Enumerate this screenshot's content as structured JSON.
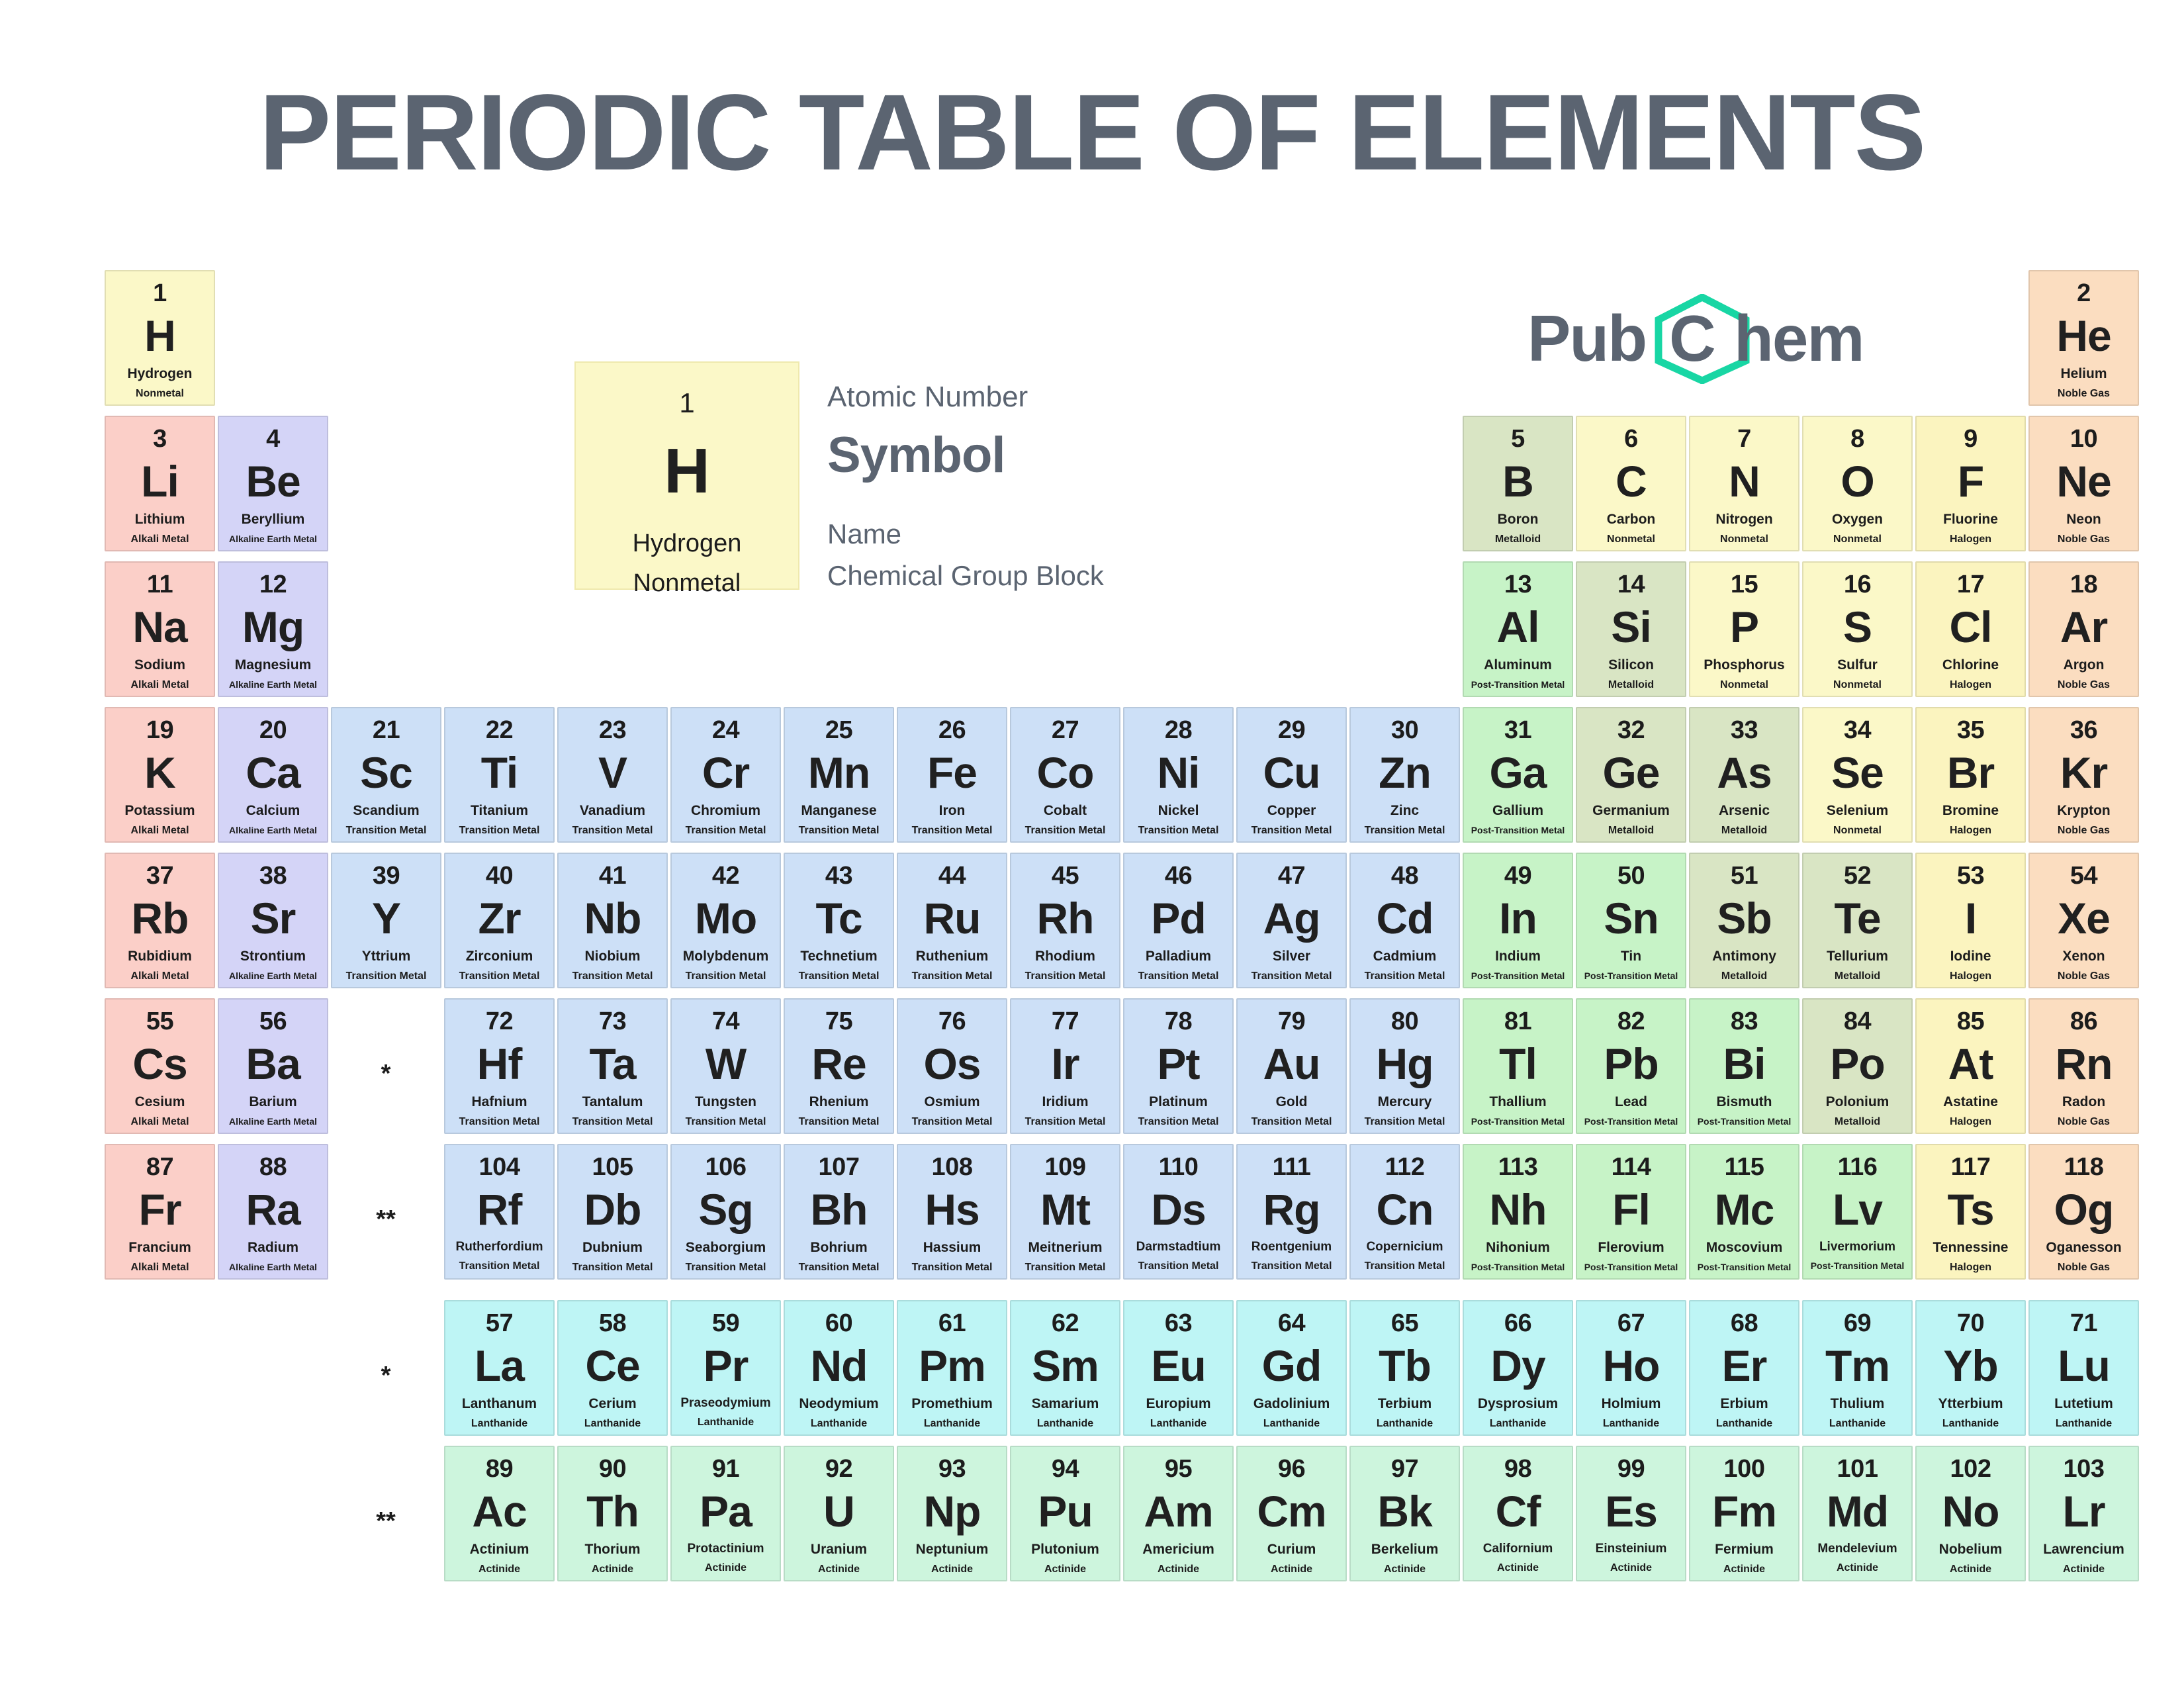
{
  "title": "PERIODIC TABLE OF ELEMENTS",
  "legend": {
    "number": "1",
    "symbol": "H",
    "name": "Hydrogen",
    "group_block": "Nonmetal",
    "label_atomic_number": "Atomic Number",
    "label_symbol": "Symbol",
    "label_name": "Name",
    "label_group_block": "Chemical Group Block"
  },
  "logo": {
    "part1": "Pub",
    "part2": "C",
    "part3": "hem",
    "hex_color": "#18d6a4",
    "text_color": "#5b6471"
  },
  "markers": {
    "lanthanide": "*",
    "actinide": "**"
  },
  "category_colors": {
    "Nonmetal": "#fbf8c8",
    "Noble Gas": "#fbddc0",
    "Alkali Metal": "#fbcfc8",
    "Alkaline Earth Metal": "#d4d4f7",
    "Metalloid": "#d9e5c4",
    "Halogen": "#fbf4bf",
    "Post-Transition Metal": "#c7f3c7",
    "Transition Metal": "#cde0f7",
    "Lanthanide": "#bef5f5",
    "Actinide": "#cdf5dd"
  },
  "elements": [
    {
      "n": 1,
      "s": "H",
      "name": "Hydrogen",
      "g": "Nonmetal",
      "col": 1,
      "row": 1
    },
    {
      "n": 2,
      "s": "He",
      "name": "Helium",
      "g": "Noble Gas",
      "col": 18,
      "row": 1
    },
    {
      "n": 3,
      "s": "Li",
      "name": "Lithium",
      "g": "Alkali Metal",
      "col": 1,
      "row": 2
    },
    {
      "n": 4,
      "s": "Be",
      "name": "Beryllium",
      "g": "Alkaline Earth Metal",
      "col": 2,
      "row": 2
    },
    {
      "n": 5,
      "s": "B",
      "name": "Boron",
      "g": "Metalloid",
      "col": 13,
      "row": 2
    },
    {
      "n": 6,
      "s": "C",
      "name": "Carbon",
      "g": "Nonmetal",
      "col": 14,
      "row": 2
    },
    {
      "n": 7,
      "s": "N",
      "name": "Nitrogen",
      "g": "Nonmetal",
      "col": 15,
      "row": 2
    },
    {
      "n": 8,
      "s": "O",
      "name": "Oxygen",
      "g": "Nonmetal",
      "col": 16,
      "row": 2
    },
    {
      "n": 9,
      "s": "F",
      "name": "Fluorine",
      "g": "Halogen",
      "col": 17,
      "row": 2
    },
    {
      "n": 10,
      "s": "Ne",
      "name": "Neon",
      "g": "Noble Gas",
      "col": 18,
      "row": 2
    },
    {
      "n": 11,
      "s": "Na",
      "name": "Sodium",
      "g": "Alkali Metal",
      "col": 1,
      "row": 3
    },
    {
      "n": 12,
      "s": "Mg",
      "name": "Magnesium",
      "g": "Alkaline Earth Metal",
      "col": 2,
      "row": 3
    },
    {
      "n": 13,
      "s": "Al",
      "name": "Aluminum",
      "g": "Post-Transition Metal",
      "col": 13,
      "row": 3
    },
    {
      "n": 14,
      "s": "Si",
      "name": "Silicon",
      "g": "Metalloid",
      "col": 14,
      "row": 3
    },
    {
      "n": 15,
      "s": "P",
      "name": "Phosphorus",
      "g": "Nonmetal",
      "col": 15,
      "row": 3
    },
    {
      "n": 16,
      "s": "S",
      "name": "Sulfur",
      "g": "Nonmetal",
      "col": 16,
      "row": 3
    },
    {
      "n": 17,
      "s": "Cl",
      "name": "Chlorine",
      "g": "Halogen",
      "col": 17,
      "row": 3
    },
    {
      "n": 18,
      "s": "Ar",
      "name": "Argon",
      "g": "Noble Gas",
      "col": 18,
      "row": 3
    },
    {
      "n": 19,
      "s": "K",
      "name": "Potassium",
      "g": "Alkali Metal",
      "col": 1,
      "row": 4
    },
    {
      "n": 20,
      "s": "Ca",
      "name": "Calcium",
      "g": "Alkaline Earth Metal",
      "col": 2,
      "row": 4
    },
    {
      "n": 21,
      "s": "Sc",
      "name": "Scandium",
      "g": "Transition Metal",
      "col": 3,
      "row": 4
    },
    {
      "n": 22,
      "s": "Ti",
      "name": "Titanium",
      "g": "Transition Metal",
      "col": 4,
      "row": 4
    },
    {
      "n": 23,
      "s": "V",
      "name": "Vanadium",
      "g": "Transition Metal",
      "col": 5,
      "row": 4
    },
    {
      "n": 24,
      "s": "Cr",
      "name": "Chromium",
      "g": "Transition Metal",
      "col": 6,
      "row": 4
    },
    {
      "n": 25,
      "s": "Mn",
      "name": "Manganese",
      "g": "Transition Metal",
      "col": 7,
      "row": 4
    },
    {
      "n": 26,
      "s": "Fe",
      "name": "Iron",
      "g": "Transition Metal",
      "col": 8,
      "row": 4
    },
    {
      "n": 27,
      "s": "Co",
      "name": "Cobalt",
      "g": "Transition Metal",
      "col": 9,
      "row": 4
    },
    {
      "n": 28,
      "s": "Ni",
      "name": "Nickel",
      "g": "Transition Metal",
      "col": 10,
      "row": 4
    },
    {
      "n": 29,
      "s": "Cu",
      "name": "Copper",
      "g": "Transition Metal",
      "col": 11,
      "row": 4
    },
    {
      "n": 30,
      "s": "Zn",
      "name": "Zinc",
      "g": "Transition Metal",
      "col": 12,
      "row": 4
    },
    {
      "n": 31,
      "s": "Ga",
      "name": "Gallium",
      "g": "Post-Transition Metal",
      "col": 13,
      "row": 4
    },
    {
      "n": 32,
      "s": "Ge",
      "name": "Germanium",
      "g": "Metalloid",
      "col": 14,
      "row": 4
    },
    {
      "n": 33,
      "s": "As",
      "name": "Arsenic",
      "g": "Metalloid",
      "col": 15,
      "row": 4
    },
    {
      "n": 34,
      "s": "Se",
      "name": "Selenium",
      "g": "Nonmetal",
      "col": 16,
      "row": 4
    },
    {
      "n": 35,
      "s": "Br",
      "name": "Bromine",
      "g": "Halogen",
      "col": 17,
      "row": 4
    },
    {
      "n": 36,
      "s": "Kr",
      "name": "Krypton",
      "g": "Noble Gas",
      "col": 18,
      "row": 4
    },
    {
      "n": 37,
      "s": "Rb",
      "name": "Rubidium",
      "g": "Alkali Metal",
      "col": 1,
      "row": 5
    },
    {
      "n": 38,
      "s": "Sr",
      "name": "Strontium",
      "g": "Alkaline Earth Metal",
      "col": 2,
      "row": 5
    },
    {
      "n": 39,
      "s": "Y",
      "name": "Yttrium",
      "g": "Transition Metal",
      "col": 3,
      "row": 5
    },
    {
      "n": 40,
      "s": "Zr",
      "name": "Zirconium",
      "g": "Transition Metal",
      "col": 4,
      "row": 5
    },
    {
      "n": 41,
      "s": "Nb",
      "name": "Niobium",
      "g": "Transition Metal",
      "col": 5,
      "row": 5
    },
    {
      "n": 42,
      "s": "Mo",
      "name": "Molybdenum",
      "g": "Transition Metal",
      "col": 6,
      "row": 5
    },
    {
      "n": 43,
      "s": "Tc",
      "name": "Technetium",
      "g": "Transition Metal",
      "col": 7,
      "row": 5
    },
    {
      "n": 44,
      "s": "Ru",
      "name": "Ruthenium",
      "g": "Transition Metal",
      "col": 8,
      "row": 5
    },
    {
      "n": 45,
      "s": "Rh",
      "name": "Rhodium",
      "g": "Transition Metal",
      "col": 9,
      "row": 5
    },
    {
      "n": 46,
      "s": "Pd",
      "name": "Palladium",
      "g": "Transition Metal",
      "col": 10,
      "row": 5
    },
    {
      "n": 47,
      "s": "Ag",
      "name": "Silver",
      "g": "Transition Metal",
      "col": 11,
      "row": 5
    },
    {
      "n": 48,
      "s": "Cd",
      "name": "Cadmium",
      "g": "Transition Metal",
      "col": 12,
      "row": 5
    },
    {
      "n": 49,
      "s": "In",
      "name": "Indium",
      "g": "Post-Transition Metal",
      "col": 13,
      "row": 5
    },
    {
      "n": 50,
      "s": "Sn",
      "name": "Tin",
      "g": "Post-Transition Metal",
      "col": 14,
      "row": 5
    },
    {
      "n": 51,
      "s": "Sb",
      "name": "Antimony",
      "g": "Metalloid",
      "col": 15,
      "row": 5
    },
    {
      "n": 52,
      "s": "Te",
      "name": "Tellurium",
      "g": "Metalloid",
      "col": 16,
      "row": 5
    },
    {
      "n": 53,
      "s": "I",
      "name": "Iodine",
      "g": "Halogen",
      "col": 17,
      "row": 5
    },
    {
      "n": 54,
      "s": "Xe",
      "name": "Xenon",
      "g": "Noble Gas",
      "col": 18,
      "row": 5
    },
    {
      "n": 55,
      "s": "Cs",
      "name": "Cesium",
      "g": "Alkali Metal",
      "col": 1,
      "row": 6
    },
    {
      "n": 56,
      "s": "Ba",
      "name": "Barium",
      "g": "Alkaline Earth Metal",
      "col": 2,
      "row": 6
    },
    {
      "n": 72,
      "s": "Hf",
      "name": "Hafnium",
      "g": "Transition Metal",
      "col": 4,
      "row": 6
    },
    {
      "n": 73,
      "s": "Ta",
      "name": "Tantalum",
      "g": "Transition Metal",
      "col": 5,
      "row": 6
    },
    {
      "n": 74,
      "s": "W",
      "name": "Tungsten",
      "g": "Transition Metal",
      "col": 6,
      "row": 6
    },
    {
      "n": 75,
      "s": "Re",
      "name": "Rhenium",
      "g": "Transition Metal",
      "col": 7,
      "row": 6
    },
    {
      "n": 76,
      "s": "Os",
      "name": "Osmium",
      "g": "Transition Metal",
      "col": 8,
      "row": 6
    },
    {
      "n": 77,
      "s": "Ir",
      "name": "Iridium",
      "g": "Transition Metal",
      "col": 9,
      "row": 6
    },
    {
      "n": 78,
      "s": "Pt",
      "name": "Platinum",
      "g": "Transition Metal",
      "col": 10,
      "row": 6
    },
    {
      "n": 79,
      "s": "Au",
      "name": "Gold",
      "g": "Transition Metal",
      "col": 11,
      "row": 6
    },
    {
      "n": 80,
      "s": "Hg",
      "name": "Mercury",
      "g": "Transition Metal",
      "col": 12,
      "row": 6
    },
    {
      "n": 81,
      "s": "Tl",
      "name": "Thallium",
      "g": "Post-Transition Metal",
      "col": 13,
      "row": 6
    },
    {
      "n": 82,
      "s": "Pb",
      "name": "Lead",
      "g": "Post-Transition Metal",
      "col": 14,
      "row": 6
    },
    {
      "n": 83,
      "s": "Bi",
      "name": "Bismuth",
      "g": "Post-Transition Metal",
      "col": 15,
      "row": 6
    },
    {
      "n": 84,
      "s": "Po",
      "name": "Polonium",
      "g": "Metalloid",
      "col": 16,
      "row": 6
    },
    {
      "n": 85,
      "s": "At",
      "name": "Astatine",
      "g": "Halogen",
      "col": 17,
      "row": 6
    },
    {
      "n": 86,
      "s": "Rn",
      "name": "Radon",
      "g": "Noble Gas",
      "col": 18,
      "row": 6
    },
    {
      "n": 87,
      "s": "Fr",
      "name": "Francium",
      "g": "Alkali Metal",
      "col": 1,
      "row": 7
    },
    {
      "n": 88,
      "s": "Ra",
      "name": "Radium",
      "g": "Alkaline Earth Metal",
      "col": 2,
      "row": 7
    },
    {
      "n": 104,
      "s": "Rf",
      "name": "Rutherfordium",
      "g": "Transition Metal",
      "col": 4,
      "row": 7
    },
    {
      "n": 105,
      "s": "Db",
      "name": "Dubnium",
      "g": "Transition Metal",
      "col": 5,
      "row": 7
    },
    {
      "n": 106,
      "s": "Sg",
      "name": "Seaborgium",
      "g": "Transition Metal",
      "col": 6,
      "row": 7
    },
    {
      "n": 107,
      "s": "Bh",
      "name": "Bohrium",
      "g": "Transition Metal",
      "col": 7,
      "row": 7
    },
    {
      "n": 108,
      "s": "Hs",
      "name": "Hassium",
      "g": "Transition Metal",
      "col": 8,
      "row": 7
    },
    {
      "n": 109,
      "s": "Mt",
      "name": "Meitnerium",
      "g": "Transition Metal",
      "col": 9,
      "row": 7
    },
    {
      "n": 110,
      "s": "Ds",
      "name": "Darmstadtium",
      "g": "Transition Metal",
      "col": 10,
      "row": 7
    },
    {
      "n": 111,
      "s": "Rg",
      "name": "Roentgenium",
      "g": "Transition Metal",
      "col": 11,
      "row": 7
    },
    {
      "n": 112,
      "s": "Cn",
      "name": "Copernicium",
      "g": "Transition Metal",
      "col": 12,
      "row": 7
    },
    {
      "n": 113,
      "s": "Nh",
      "name": "Nihonium",
      "g": "Post-Transition Metal",
      "col": 13,
      "row": 7
    },
    {
      "n": 114,
      "s": "Fl",
      "name": "Flerovium",
      "g": "Post-Transition Metal",
      "col": 14,
      "row": 7
    },
    {
      "n": 115,
      "s": "Mc",
      "name": "Moscovium",
      "g": "Post-Transition Metal",
      "col": 15,
      "row": 7
    },
    {
      "n": 116,
      "s": "Lv",
      "name": "Livermorium",
      "g": "Post-Transition Metal",
      "col": 16,
      "row": 7
    },
    {
      "n": 117,
      "s": "Ts",
      "name": "Tennessine",
      "g": "Halogen",
      "col": 17,
      "row": 7
    },
    {
      "n": 118,
      "s": "Og",
      "name": "Oganesson",
      "g": "Noble Gas",
      "col": 18,
      "row": 7
    },
    {
      "n": 57,
      "s": "La",
      "name": "Lanthanum",
      "g": "Lanthanide",
      "col": 4,
      "row": 8
    },
    {
      "n": 58,
      "s": "Ce",
      "name": "Cerium",
      "g": "Lanthanide",
      "col": 5,
      "row": 8
    },
    {
      "n": 59,
      "s": "Pr",
      "name": "Praseodymium",
      "g": "Lanthanide",
      "col": 6,
      "row": 8
    },
    {
      "n": 60,
      "s": "Nd",
      "name": "Neodymium",
      "g": "Lanthanide",
      "col": 7,
      "row": 8
    },
    {
      "n": 61,
      "s": "Pm",
      "name": "Promethium",
      "g": "Lanthanide",
      "col": 8,
      "row": 8
    },
    {
      "n": 62,
      "s": "Sm",
      "name": "Samarium",
      "g": "Lanthanide",
      "col": 9,
      "row": 8
    },
    {
      "n": 63,
      "s": "Eu",
      "name": "Europium",
      "g": "Lanthanide",
      "col": 10,
      "row": 8
    },
    {
      "n": 64,
      "s": "Gd",
      "name": "Gadolinium",
      "g": "Lanthanide",
      "col": 11,
      "row": 8
    },
    {
      "n": 65,
      "s": "Tb",
      "name": "Terbium",
      "g": "Lanthanide",
      "col": 12,
      "row": 8
    },
    {
      "n": 66,
      "s": "Dy",
      "name": "Dysprosium",
      "g": "Lanthanide",
      "col": 13,
      "row": 8
    },
    {
      "n": 67,
      "s": "Ho",
      "name": "Holmium",
      "g": "Lanthanide",
      "col": 14,
      "row": 8
    },
    {
      "n": 68,
      "s": "Er",
      "name": "Erbium",
      "g": "Lanthanide",
      "col": 15,
      "row": 8
    },
    {
      "n": 69,
      "s": "Tm",
      "name": "Thulium",
      "g": "Lanthanide",
      "col": 16,
      "row": 8
    },
    {
      "n": 70,
      "s": "Yb",
      "name": "Ytterbium",
      "g": "Lanthanide",
      "col": 17,
      "row": 8
    },
    {
      "n": 71,
      "s": "Lu",
      "name": "Lutetium",
      "g": "Lanthanide",
      "col": 18,
      "row": 8
    },
    {
      "n": 89,
      "s": "Ac",
      "name": "Actinium",
      "g": "Actinide",
      "col": 4,
      "row": 9
    },
    {
      "n": 90,
      "s": "Th",
      "name": "Thorium",
      "g": "Actinide",
      "col": 5,
      "row": 9
    },
    {
      "n": 91,
      "s": "Pa",
      "name": "Protactinium",
      "g": "Actinide",
      "col": 6,
      "row": 9
    },
    {
      "n": 92,
      "s": "U",
      "name": "Uranium",
      "g": "Actinide",
      "col": 7,
      "row": 9
    },
    {
      "n": 93,
      "s": "Np",
      "name": "Neptunium",
      "g": "Actinide",
      "col": 8,
      "row": 9
    },
    {
      "n": 94,
      "s": "Pu",
      "name": "Plutonium",
      "g": "Actinide",
      "col": 9,
      "row": 9
    },
    {
      "n": 95,
      "s": "Am",
      "name": "Americium",
      "g": "Actinide",
      "col": 10,
      "row": 9
    },
    {
      "n": 96,
      "s": "Cm",
      "name": "Curium",
      "g": "Actinide",
      "col": 11,
      "row": 9
    },
    {
      "n": 97,
      "s": "Bk",
      "name": "Berkelium",
      "g": "Actinide",
      "col": 12,
      "row": 9
    },
    {
      "n": 98,
      "s": "Cf",
      "name": "Californium",
      "g": "Actinide",
      "col": 13,
      "row": 9
    },
    {
      "n": 99,
      "s": "Es",
      "name": "Einsteinium",
      "g": "Actinide",
      "col": 14,
      "row": 9
    },
    {
      "n": 100,
      "s": "Fm",
      "name": "Fermium",
      "g": "Actinide",
      "col": 15,
      "row": 9
    },
    {
      "n": 101,
      "s": "Md",
      "name": "Mendelevium",
      "g": "Actinide",
      "col": 16,
      "row": 9
    },
    {
      "n": 102,
      "s": "No",
      "name": "Nobelium",
      "g": "Actinide",
      "col": 17,
      "row": 9
    },
    {
      "n": 103,
      "s": "Lr",
      "name": "Lawrencium",
      "g": "Actinide",
      "col": 18,
      "row": 9
    }
  ]
}
